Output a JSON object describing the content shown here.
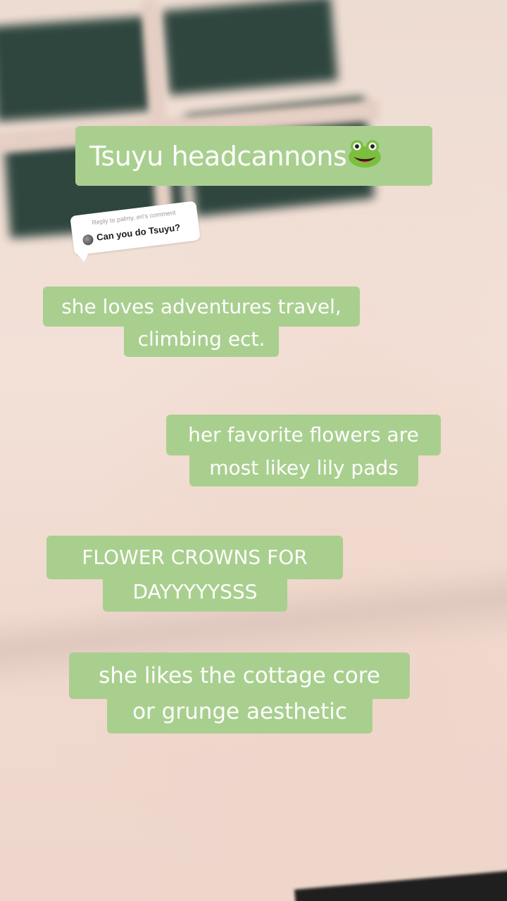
{
  "title": {
    "text": "Tsuyu headcannons",
    "emoji": "🐸"
  },
  "reply": {
    "header": "Reply to palmy..eri's comment",
    "comment": "Can you do Tsuyu?"
  },
  "captions": [
    [
      "she loves adventures travel,",
      "climbing ect."
    ],
    [
      "her favorite flowers are",
      "most likey lily pads"
    ],
    [
      "FLOWER CROWNS FOR",
      "DAYYYYYSSS"
    ],
    [
      "she likes the cottage core",
      "or grunge aesthetic"
    ]
  ],
  "colors": {
    "label_bg": "#a9cf8f",
    "label_text": "#ffffff",
    "background": "#f1ddd3"
  }
}
